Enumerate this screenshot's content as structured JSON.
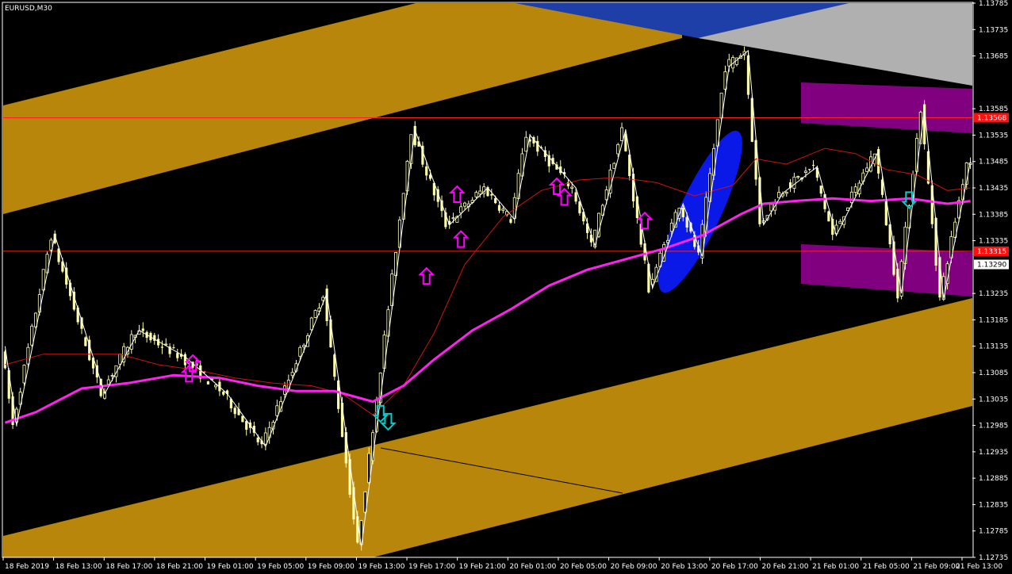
{
  "window": {
    "title": "EURUSD,M30"
  },
  "colors": {
    "background": "#000000",
    "candle": "#FFFFAA",
    "zigzag": "#FFFFFF",
    "ma_fast": "#D01010",
    "ma_slow": "#FF22EE",
    "channel": "#B8860B",
    "band_top_right": "#B0B0B0",
    "band_top_blue": "#1E3EA8",
    "purple_zone": "#800080",
    "ellipse": "#0A18E8",
    "arrow_up": "#FF00FF",
    "arrow_down": "#00CCCC",
    "hline": "#FF2020",
    "price_badge_red": "#FF1010",
    "price_badge_white": "#FFFFFF"
  },
  "price_axis": {
    "min": 1.12735,
    "max": 1.13785,
    "ticks": [
      "1.13785",
      "1.13735",
      "1.13685",
      "1.13585",
      "1.13535",
      "1.13485",
      "1.13435",
      "1.13385",
      "1.13335",
      "1.13235",
      "1.13185",
      "1.13135",
      "1.13085",
      "1.13035",
      "1.12985",
      "1.12935",
      "1.12885",
      "1.12835",
      "1.12785",
      "1.12735"
    ],
    "badges": [
      {
        "label": "1.13568",
        "value": 1.13568,
        "style": "red"
      },
      {
        "label": "1.13315",
        "value": 1.13315,
        "style": "red"
      },
      {
        "label": "1.13290",
        "value": 1.1329,
        "style": "white"
      }
    ]
  },
  "time_axis": {
    "labels": [
      "18 Feb 2019",
      "18 Feb 13:00",
      "18 Feb 17:00",
      "18 Feb 21:00",
      "19 Feb 01:00",
      "19 Feb 05:00",
      "19 Feb 09:00",
      "19 Feb 13:00",
      "19 Feb 17:00",
      "19 Feb 21:00",
      "20 Feb 01:00",
      "20 Feb 05:00",
      "20 Feb 09:00",
      "20 Feb 13:00",
      "20 Feb 17:00",
      "20 Feb 21:00",
      "21 Feb 01:00",
      "21 Feb 05:00",
      "21 Feb 09:00",
      "21 Feb 13:00"
    ]
  },
  "chart_data": {
    "type": "candlestick",
    "symbol": "EURUSD",
    "timeframe": "M30",
    "ylim": [
      1.12735,
      1.13785
    ],
    "zigzag": [
      [
        0,
        1.13135
      ],
      [
        3,
        1.12985
      ],
      [
        13,
        1.13345
      ],
      [
        26,
        1.13045
      ],
      [
        35,
        1.13165
      ],
      [
        47,
        1.13115
      ],
      [
        58,
        1.13045
      ],
      [
        68,
        1.12945
      ],
      [
        84,
        1.13235
      ],
      [
        93,
        1.12755
      ],
      [
        107,
        1.13545
      ],
      [
        116,
        1.13365
      ],
      [
        126,
        1.13435
      ],
      [
        133,
        1.13375
      ],
      [
        137,
        1.13535
      ],
      [
        149,
        1.13435
      ],
      [
        154,
        1.13325
      ],
      [
        162,
        1.13545
      ],
      [
        169,
        1.13245
      ],
      [
        177,
        1.13405
      ],
      [
        182,
        1.13305
      ],
      [
        189,
        1.13665
      ],
      [
        194,
        1.13695
      ],
      [
        198,
        1.13365
      ],
      [
        203,
        1.13425
      ],
      [
        212,
        1.13475
      ],
      [
        217,
        1.13345
      ],
      [
        228,
        1.13505
      ],
      [
        234,
        1.13235
      ],
      [
        240,
        1.13585
      ],
      [
        245,
        1.13225
      ],
      [
        252,
        1.13485
      ]
    ],
    "ma_fast": [
      [
        0,
        1.131
      ],
      [
        10,
        1.1312
      ],
      [
        20,
        1.1312
      ],
      [
        30,
        1.1312
      ],
      [
        40,
        1.131
      ],
      [
        50,
        1.1309
      ],
      [
        60,
        1.13075
      ],
      [
        70,
        1.13065
      ],
      [
        80,
        1.1306
      ],
      [
        88,
        1.13045
      ],
      [
        96,
        1.13005
      ],
      [
        104,
        1.1306
      ],
      [
        112,
        1.1316
      ],
      [
        120,
        1.1329
      ],
      [
        130,
        1.1338
      ],
      [
        140,
        1.1343
      ],
      [
        150,
        1.1345
      ],
      [
        160,
        1.13455
      ],
      [
        170,
        1.13445
      ],
      [
        180,
        1.1342
      ],
      [
        190,
        1.1344
      ],
      [
        196,
        1.1349
      ],
      [
        204,
        1.1348
      ],
      [
        214,
        1.1351
      ],
      [
        222,
        1.135
      ],
      [
        230,
        1.1347
      ],
      [
        238,
        1.1346
      ],
      [
        246,
        1.1343
      ],
      [
        252,
        1.13435
      ]
    ],
    "ma_slow": [
      [
        0,
        1.1299
      ],
      [
        8,
        1.1301
      ],
      [
        20,
        1.13055
      ],
      [
        32,
        1.13065
      ],
      [
        44,
        1.1308
      ],
      [
        56,
        1.13075
      ],
      [
        66,
        1.1306
      ],
      [
        76,
        1.1305
      ],
      [
        86,
        1.1305
      ],
      [
        96,
        1.1303
      ],
      [
        104,
        1.1306
      ],
      [
        112,
        1.1311
      ],
      [
        122,
        1.13165
      ],
      [
        132,
        1.13205
      ],
      [
        142,
        1.1325
      ],
      [
        152,
        1.1328
      ],
      [
        162,
        1.133
      ],
      [
        172,
        1.1332
      ],
      [
        182,
        1.13345
      ],
      [
        192,
        1.13385
      ],
      [
        198,
        1.13405
      ],
      [
        206,
        1.1341
      ],
      [
        216,
        1.13415
      ],
      [
        226,
        1.1341
      ],
      [
        236,
        1.13415
      ],
      [
        246,
        1.13405
      ],
      [
        252,
        1.1341
      ]
    ],
    "hlines": [
      1.13568,
      1.13315
    ],
    "arrows_up": [
      [
        48,
        1.1308
      ],
      [
        49,
        1.131
      ],
      [
        110,
        1.13265
      ],
      [
        118,
        1.1342
      ],
      [
        119,
        1.13335
      ],
      [
        144,
        1.13435
      ],
      [
        146,
        1.13415
      ],
      [
        167,
        1.1337
      ]
    ],
    "arrows_down": [
      [
        98,
        1.1301
      ],
      [
        100,
        1.12995
      ],
      [
        236,
        1.13415
      ]
    ]
  }
}
